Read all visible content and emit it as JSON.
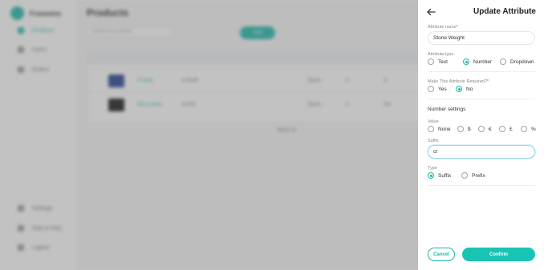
{
  "app": {
    "brand": "Frameinc",
    "nav": [
      {
        "label": "Products"
      },
      {
        "label": "Users"
      },
      {
        "label": "Orders"
      }
    ],
    "nav_bottom": [
      {
        "label": "Settings"
      },
      {
        "label": "Help & FAQ"
      },
      {
        "label": "Logout"
      }
    ],
    "page_title": "Products",
    "search_placeholder": "Search for product",
    "add_label": "Add",
    "rows": [
      {
        "name": "Product",
        "price": "£ 26.00",
        "status": "Stock I",
        "qty": "5",
        "extra": "0"
      },
      {
        "name": "Gift product",
        "price": "£ 0.00",
        "status": "Stock I",
        "qty": "3",
        "extra": "No"
      }
    ],
    "pager": "Items 10"
  },
  "drawer": {
    "title": "Update Attribute",
    "name_label": "Attribute name",
    "required_mark": "*",
    "name_value": "Stone Weight",
    "type_label": "Attribute type",
    "type_options": [
      "Text",
      "Number",
      "Dropdown"
    ],
    "type_selected": "Number",
    "required_label": "Make This Attribute Required?",
    "required_mark2": "*",
    "required_options": [
      "Yes",
      "No"
    ],
    "required_selected": "No",
    "number_settings_heading": "Number settings",
    "value_label": "Value",
    "value_options": [
      "None",
      "$",
      "€",
      "£",
      "%"
    ],
    "suffix_label": "Suffix",
    "suffix_value": "ct",
    "position_label": "Type",
    "position_options": [
      "Suffix",
      "Prefix"
    ],
    "position_selected": "Suffix",
    "cancel_label": "Cancel",
    "confirm_label": "Confirm"
  },
  "colors": {
    "accent": "#18b7a8",
    "confirm": "#18c4b3",
    "required": "#e64545"
  },
  "icons": {
    "back": "arrow-left-icon"
  }
}
